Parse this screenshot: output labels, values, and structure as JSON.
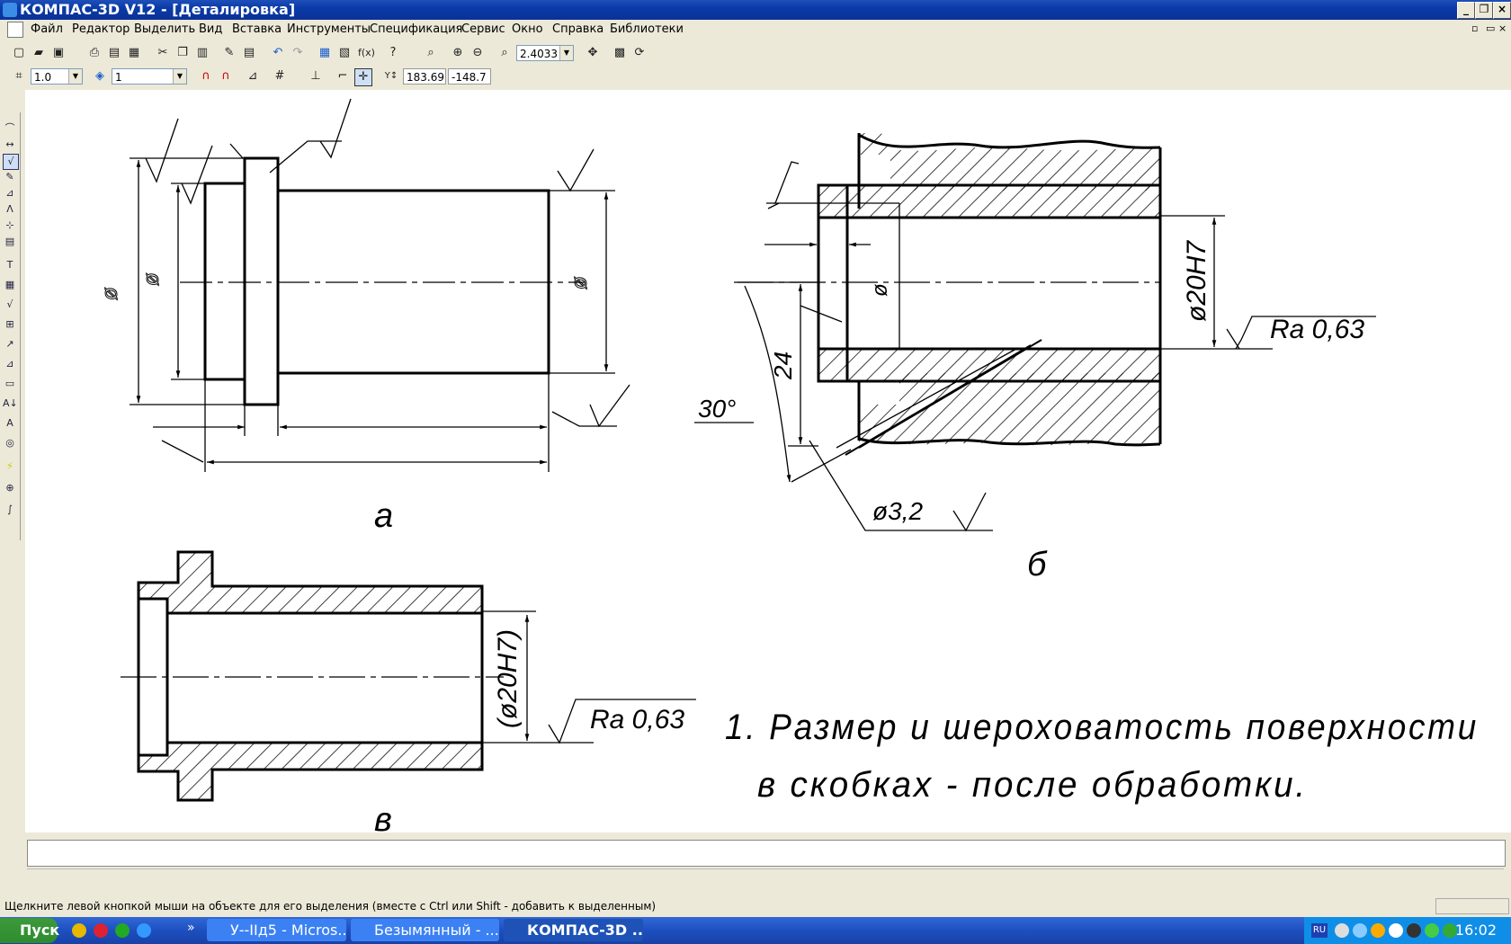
{
  "window": {
    "title": "КОМПАС-3D V12 - [Деталировка]"
  },
  "menu": [
    "Файл",
    "Редактор",
    "Выделить",
    "Вид",
    "Вставка",
    "Инструменты",
    "Спецификация",
    "Сервис",
    "Окно",
    "Справка",
    "Библиотеки"
  ],
  "toolbar": {
    "zoom_value": "2.4033",
    "step_value": "1.0",
    "layer_value": "1",
    "coord_x": "183.69",
    "coord_y": "-148.7"
  },
  "drawing": {
    "label_a": "а",
    "label_b": "б",
    "label_v": "в",
    "dim_phi": "ø",
    "dim_phi20h7": "ø20H7",
    "dim_phi20h7_paren": "(ø20H7)",
    "ra_value": "Ra 0,63",
    "dim_24": "24",
    "dim_30deg": "30°",
    "dim_phi32": "ø3,2",
    "note_line1": "1. Размер и шероховатость поверхности",
    "note_line2": "в скобках - после обработки."
  },
  "status": {
    "hint": "Щелкните левой кнопкой мыши на объекте для его выделения (вместе с Ctrl или Shift - добавить к выделенным)"
  },
  "taskbar": {
    "start_label": "Пуск",
    "tasks": [
      "У--IIд5 - Micros...",
      "Безымянный - ...",
      "КОМПАС-3D ..."
    ],
    "clock": "16:02",
    "lang": "RU"
  }
}
